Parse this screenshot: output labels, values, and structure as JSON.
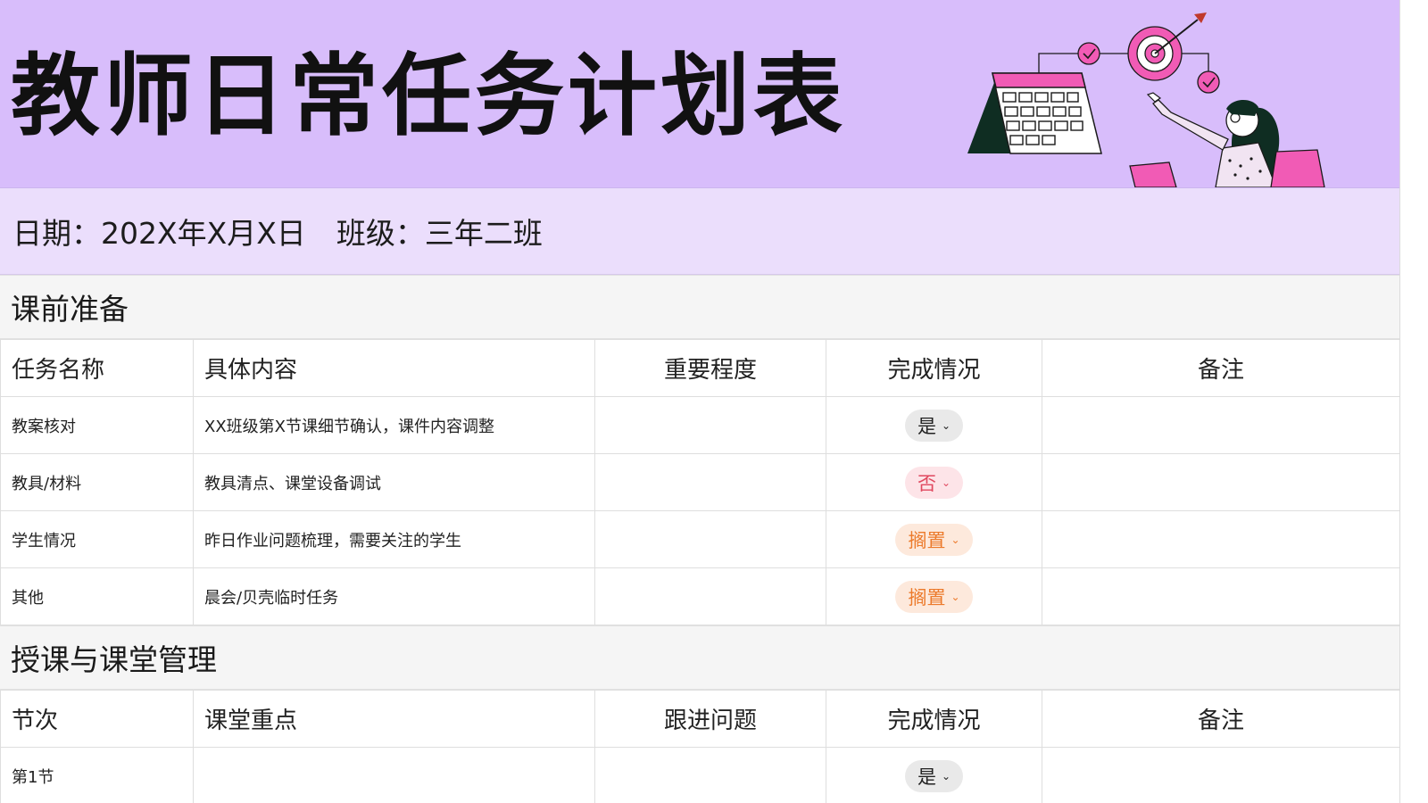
{
  "title": "教师日常任务计划表",
  "info": {
    "date_label": "日期：",
    "date_value": "202X年X月X日",
    "class_label": "班级：",
    "class_value": "三年二班"
  },
  "section1": {
    "title": "课前准备",
    "headers": [
      "任务名称",
      "具体内容",
      "重要程度",
      "完成情况",
      "备注"
    ],
    "rows": [
      {
        "name": "教案核对",
        "content": "XX班级第X节课细节确认，课件内容调整",
        "importance": "",
        "status": "是",
        "status_type": "yes",
        "note": ""
      },
      {
        "name": "教具/材料",
        "content": "教具清点、课堂设备调试",
        "importance": "",
        "status": "否",
        "status_type": "no",
        "note": ""
      },
      {
        "name": "学生情况",
        "content": "昨日作业问题梳理，需要关注的学生",
        "importance": "",
        "status": "搁置",
        "status_type": "hold",
        "note": ""
      },
      {
        "name": "其他",
        "content": "晨会/贝壳临时任务",
        "importance": "",
        "status": "搁置",
        "status_type": "hold",
        "note": ""
      }
    ]
  },
  "section2": {
    "title": "授课与课堂管理",
    "headers": [
      "节次",
      "课堂重点",
      "跟进问题",
      "完成情况",
      "备注"
    ],
    "rows": [
      {
        "name": "第1节",
        "content": "",
        "followup": "",
        "status": "是",
        "status_type": "yes",
        "note": ""
      }
    ]
  },
  "colors": {
    "header_bg": "#d8bdfb",
    "info_bg": "#ebdefc",
    "section_bg": "#f5f5f5",
    "status_yes_bg": "#e9e9e9",
    "status_no_bg": "#fde4e8",
    "status_no_text": "#e0485f",
    "status_hold_bg": "#fde9dc",
    "status_hold_text": "#ec7a2b"
  },
  "icons": {
    "illustration": "teacher-calendar-target-illustration",
    "dropdown": "chevron-down-icon"
  }
}
